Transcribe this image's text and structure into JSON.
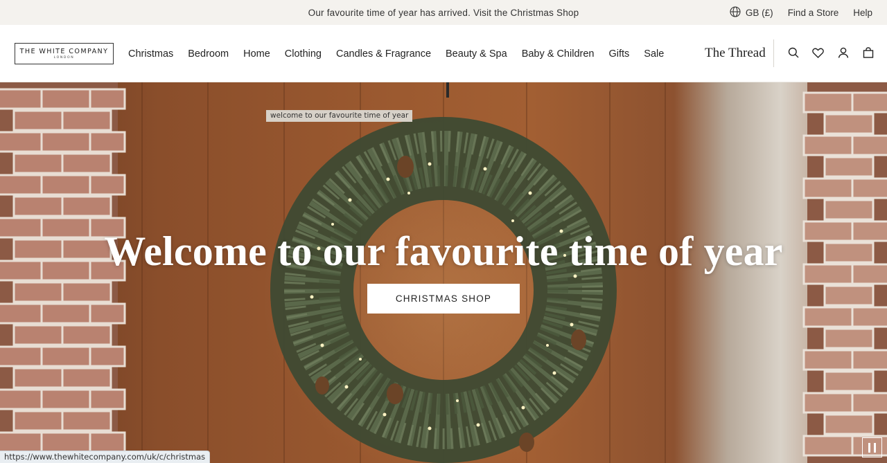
{
  "announcement": {
    "message": "Our favourite time of year has arrived. Visit the Christmas Shop",
    "locale": "GB (£)",
    "find_store": "Find a Store",
    "help": "Help"
  },
  "header": {
    "logo": {
      "name": "THE WHITE COMPANY",
      "sub": "LONDON"
    },
    "nav": [
      "Christmas",
      "Bedroom",
      "Home",
      "Clothing",
      "Candles & Fragrance",
      "Beauty & Spa",
      "Baby & Children",
      "Gifts",
      "Sale"
    ],
    "thread_link": "The Thread",
    "icons": [
      "search-icon",
      "heart-icon",
      "account-icon",
      "bag-icon"
    ]
  },
  "hero": {
    "caption": "welcome to our favourite time of year",
    "title": "Welcome to our favourite time of year",
    "cta": "CHRISTMAS SHOP",
    "pause_icon": "pause-icon"
  },
  "status_bar": {
    "url": "https://www.thewhitecompany.com/uk/c/christmas"
  }
}
